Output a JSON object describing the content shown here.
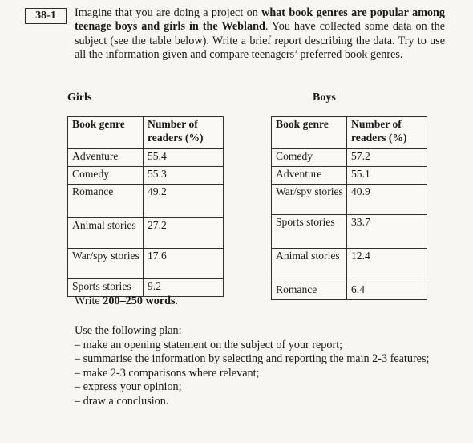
{
  "task": {
    "number": "38-1",
    "prompt_parts": [
      {
        "text": "Imagine that you are doing a project on ",
        "bold": false
      },
      {
        "text": "what book genres are popular among teenage boys and girls in the Webland",
        "bold": true
      },
      {
        "text": ". You have collected some data on the subject (see the table below). Write a brief report describing the data. Try to use all the information given and compare teenagers’ preferred book genres.",
        "bold": false
      }
    ]
  },
  "tables": [
    {
      "caption": "Girls",
      "headers": [
        "Book genre",
        "Number of readers (%)"
      ],
      "rows": [
        {
          "genre": "Adventure",
          "value": "55.4",
          "size": "normal"
        },
        {
          "genre": "Comedy",
          "value": "55.3",
          "size": "normal"
        },
        {
          "genre": "Romance",
          "value": "49.2",
          "size": "xtall"
        },
        {
          "genre": "Animal stories",
          "value": "27.2",
          "size": "two-line"
        },
        {
          "genre": "War/spy stories",
          "value": "17.6",
          "size": "two-line"
        },
        {
          "genre": "Sports stories",
          "value": "9.2",
          "size": "normal"
        }
      ]
    },
    {
      "caption": "Boys",
      "headers": [
        "Book genre",
        "Number of readers (%)"
      ],
      "rows": [
        {
          "genre": "Comedy",
          "value": "57.2",
          "size": "normal"
        },
        {
          "genre": "Adventure",
          "value": "55.1",
          "size": "normal"
        },
        {
          "genre": "War/spy stories",
          "value": "40.9",
          "size": "two-line"
        },
        {
          "genre": "Sports stories",
          "value": "33.7",
          "size": "xtall"
        },
        {
          "genre": "Animal stories",
          "value": "12.4",
          "size": "xtall"
        },
        {
          "genre": "Romance",
          "value": "6.4",
          "size": "normal"
        }
      ]
    }
  ],
  "chart_data": {
    "type": "table",
    "title": "Number of readers (%) by book genre",
    "categories": [
      "Adventure",
      "Comedy",
      "Romance",
      "Animal stories",
      "War/spy stories",
      "Sports stories"
    ],
    "series": [
      {
        "name": "Girls",
        "values": [
          55.4,
          55.3,
          49.2,
          27.2,
          17.6,
          9.2
        ]
      },
      {
        "name": "Boys",
        "values": [
          55.1,
          57.2,
          6.4,
          12.4,
          40.9,
          33.7
        ]
      }
    ],
    "xlabel": "Book genre",
    "ylabel": "Number of readers (%)"
  },
  "write_instruction": {
    "prefix": "Write ",
    "bold": "200–250 words",
    "suffix": "."
  },
  "plan": {
    "title": "Use the following plan:",
    "items": [
      "– make an opening statement on the subject of your report;",
      "– summarise the information by selecting and reporting the main 2-3 features;",
      "– make 2-3 comparisons where relevant;",
      "– express your opinion;",
      "– draw a conclusion."
    ]
  }
}
